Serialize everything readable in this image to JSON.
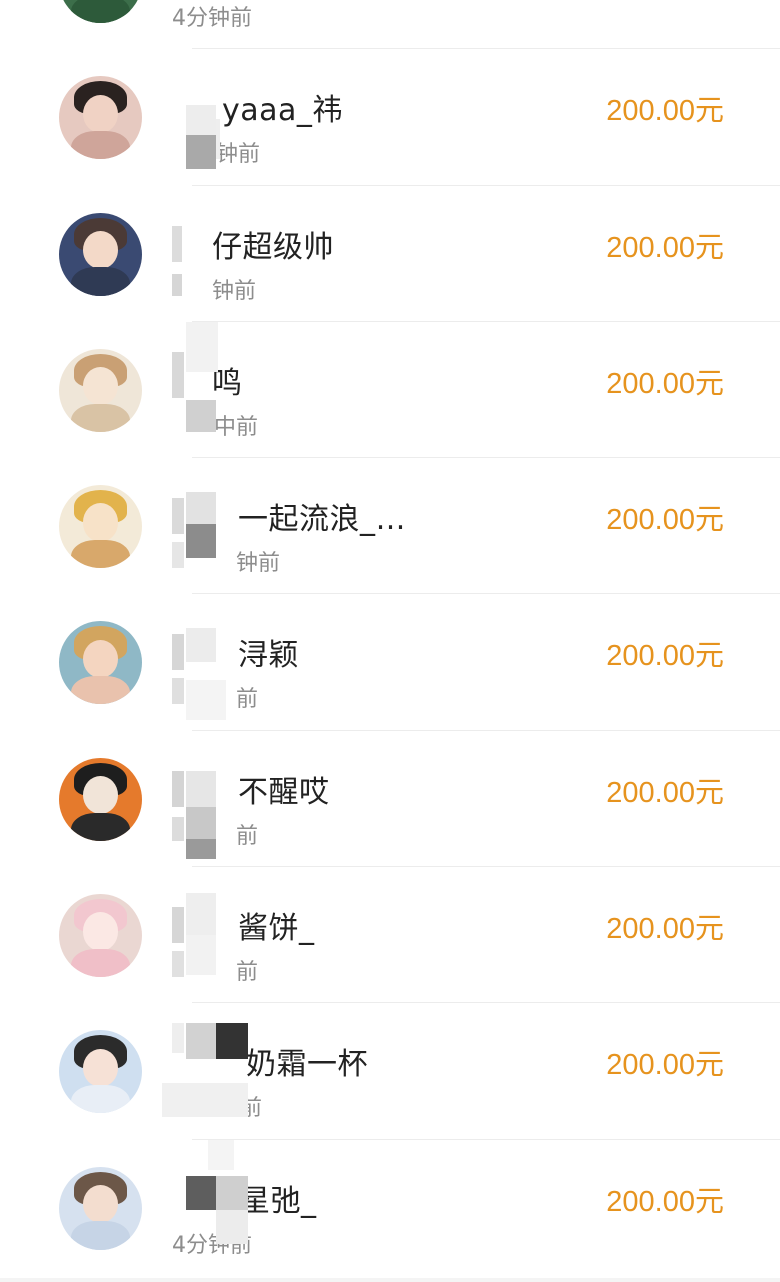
{
  "rows": [
    {
      "name": "",
      "time": "4分钟前",
      "amount": "",
      "avatar_colors": [
        "#3c6e4a",
        "#d9c28a",
        "#4a7d54"
      ]
    },
    {
      "name": "yaaa_祎",
      "time": "钟前",
      "amount": "200.00元",
      "avatar_colors": [
        "#2a2220",
        "#f0d2c4",
        "#e6c9c0"
      ]
    },
    {
      "name": "仔超级帅",
      "time": "钟前",
      "amount": "200.00元",
      "avatar_colors": [
        "#4b3a36",
        "#f3d9c8",
        "#2f3a54"
      ]
    },
    {
      "name": "鸣",
      "time": "中前",
      "amount": "200.00元",
      "avatar_colors": [
        "#c9a074",
        "#f5e4d3",
        "#e7d8c2"
      ]
    },
    {
      "name": "一起流浪_…",
      "time": "钟前",
      "amount": "200.00元",
      "avatar_colors": [
        "#e2b34c",
        "#f7e2c8",
        "#d8a86b"
      ]
    },
    {
      "name": "浔颖",
      "time": "前",
      "amount": "200.00元",
      "avatar_colors": [
        "#d2a55f",
        "#f4d5c0",
        "#8fb8c6"
      ]
    },
    {
      "name": "不醒哎",
      "time": "前",
      "amount": "200.00元",
      "avatar_colors": [
        "#1e1e1e",
        "#f1e4d8",
        "#e57a2c"
      ]
    },
    {
      "name": "酱饼_",
      "time": "前",
      "amount": "200.00元",
      "avatar_colors": [
        "#f2c7cf",
        "#fbe8e4",
        "#ead7d2"
      ]
    },
    {
      "name": "奶霜一杯",
      "time": "前",
      "amount": "200.00元",
      "avatar_colors": [
        "#2b2b2b",
        "#f6e1d6",
        "#cfdff0"
      ]
    },
    {
      "name": "星弛_",
      "time": "4分钟前",
      "amount": "200.00元",
      "avatar_colors": [
        "#6c5748",
        "#f3ddcf",
        "#d6e1ef"
      ]
    }
  ]
}
